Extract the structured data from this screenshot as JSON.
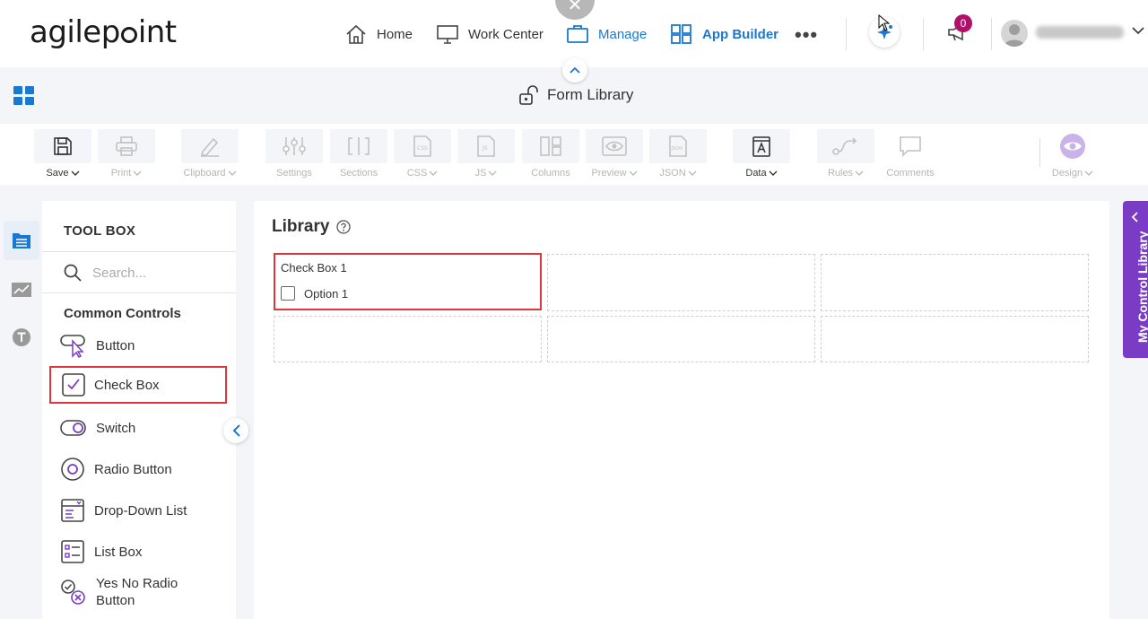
{
  "brand": {
    "logo_text_pre": "agilep",
    "logo_text_post": "int",
    "accent": "#1b78d0",
    "purple": "#7a3cc4",
    "highlight": "#e0353b"
  },
  "nav": {
    "items": [
      {
        "label": "Home"
      },
      {
        "label": "Work Center"
      },
      {
        "label": "Manage"
      },
      {
        "label": "App Builder"
      }
    ],
    "close_icon": "×",
    "more_icon": "•••",
    "notification_count": "0"
  },
  "title_row": {
    "page_title": "Form Library"
  },
  "toolbar": {
    "items": [
      {
        "label": "Save"
      },
      {
        "label": "Print"
      },
      {
        "label": "Clipboard"
      },
      {
        "label": "Settings"
      },
      {
        "label": "Sections"
      },
      {
        "label": "CSS"
      },
      {
        "label": "JS"
      },
      {
        "label": "Columns"
      },
      {
        "label": "Preview"
      },
      {
        "label": "JSON"
      },
      {
        "label": "Data"
      },
      {
        "label": "Rules"
      },
      {
        "label": "Comments"
      },
      {
        "label": "Design"
      }
    ]
  },
  "toolbox": {
    "title": "TOOL BOX",
    "search_placeholder": "Search...",
    "section": "Common Controls",
    "items": [
      {
        "label": "Button"
      },
      {
        "label": "Check Box"
      },
      {
        "label": "Switch"
      },
      {
        "label": "Radio Button"
      },
      {
        "label": "Drop-Down List"
      },
      {
        "label": "List Box"
      },
      {
        "label": "Yes No Radio",
        "label2": "Button"
      }
    ]
  },
  "canvas": {
    "title": "Library",
    "checkbox_control": {
      "label": "Check Box 1",
      "option": "Option 1"
    }
  },
  "right_tab": {
    "label": "My Control Library"
  }
}
